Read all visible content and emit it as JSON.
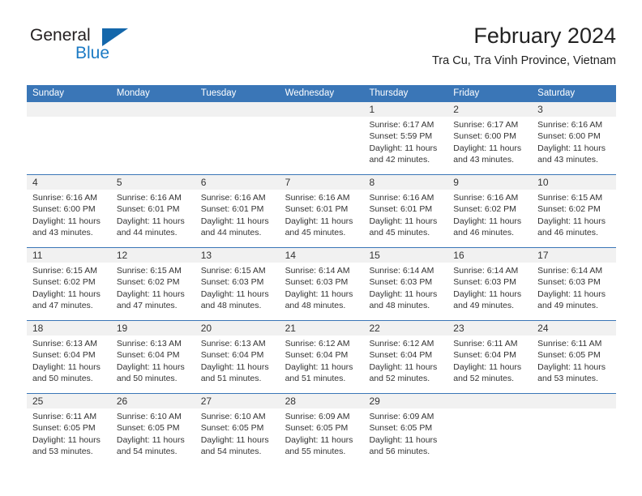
{
  "brand": {
    "name_part1": "General",
    "name_part2": "Blue",
    "triangle_icon": "blue-triangle-icon",
    "accent_color": "#1b7ac4"
  },
  "header": {
    "title": "February 2024",
    "subtitle": "Tra Cu, Tra Vinh Province, Vietnam"
  },
  "theme": {
    "header_bar_color": "#3a76b7",
    "daynum_band_color": "#f1f1f1",
    "text_color": "#333333"
  },
  "weekdays": [
    "Sunday",
    "Monday",
    "Tuesday",
    "Wednesday",
    "Thursday",
    "Friday",
    "Saturday"
  ],
  "labels": {
    "sunrise_prefix": "Sunrise:",
    "sunset_prefix": "Sunset:",
    "daylight_prefix": "Daylight:"
  },
  "weeks": [
    [
      {
        "day": "",
        "sunrise": "",
        "sunset": "",
        "daylight": ""
      },
      {
        "day": "",
        "sunrise": "",
        "sunset": "",
        "daylight": ""
      },
      {
        "day": "",
        "sunrise": "",
        "sunset": "",
        "daylight": ""
      },
      {
        "day": "",
        "sunrise": "",
        "sunset": "",
        "daylight": ""
      },
      {
        "day": "1",
        "sunrise": "Sunrise: 6:17 AM",
        "sunset": "Sunset: 5:59 PM",
        "daylight": "Daylight: 11 hours and 42 minutes."
      },
      {
        "day": "2",
        "sunrise": "Sunrise: 6:17 AM",
        "sunset": "Sunset: 6:00 PM",
        "daylight": "Daylight: 11 hours and 43 minutes."
      },
      {
        "day": "3",
        "sunrise": "Sunrise: 6:16 AM",
        "sunset": "Sunset: 6:00 PM",
        "daylight": "Daylight: 11 hours and 43 minutes."
      }
    ],
    [
      {
        "day": "4",
        "sunrise": "Sunrise: 6:16 AM",
        "sunset": "Sunset: 6:00 PM",
        "daylight": "Daylight: 11 hours and 43 minutes."
      },
      {
        "day": "5",
        "sunrise": "Sunrise: 6:16 AM",
        "sunset": "Sunset: 6:01 PM",
        "daylight": "Daylight: 11 hours and 44 minutes."
      },
      {
        "day": "6",
        "sunrise": "Sunrise: 6:16 AM",
        "sunset": "Sunset: 6:01 PM",
        "daylight": "Daylight: 11 hours and 44 minutes."
      },
      {
        "day": "7",
        "sunrise": "Sunrise: 6:16 AM",
        "sunset": "Sunset: 6:01 PM",
        "daylight": "Daylight: 11 hours and 45 minutes."
      },
      {
        "day": "8",
        "sunrise": "Sunrise: 6:16 AM",
        "sunset": "Sunset: 6:01 PM",
        "daylight": "Daylight: 11 hours and 45 minutes."
      },
      {
        "day": "9",
        "sunrise": "Sunrise: 6:16 AM",
        "sunset": "Sunset: 6:02 PM",
        "daylight": "Daylight: 11 hours and 46 minutes."
      },
      {
        "day": "10",
        "sunrise": "Sunrise: 6:15 AM",
        "sunset": "Sunset: 6:02 PM",
        "daylight": "Daylight: 11 hours and 46 minutes."
      }
    ],
    [
      {
        "day": "11",
        "sunrise": "Sunrise: 6:15 AM",
        "sunset": "Sunset: 6:02 PM",
        "daylight": "Daylight: 11 hours and 47 minutes."
      },
      {
        "day": "12",
        "sunrise": "Sunrise: 6:15 AM",
        "sunset": "Sunset: 6:02 PM",
        "daylight": "Daylight: 11 hours and 47 minutes."
      },
      {
        "day": "13",
        "sunrise": "Sunrise: 6:15 AM",
        "sunset": "Sunset: 6:03 PM",
        "daylight": "Daylight: 11 hours and 48 minutes."
      },
      {
        "day": "14",
        "sunrise": "Sunrise: 6:14 AM",
        "sunset": "Sunset: 6:03 PM",
        "daylight": "Daylight: 11 hours and 48 minutes."
      },
      {
        "day": "15",
        "sunrise": "Sunrise: 6:14 AM",
        "sunset": "Sunset: 6:03 PM",
        "daylight": "Daylight: 11 hours and 48 minutes."
      },
      {
        "day": "16",
        "sunrise": "Sunrise: 6:14 AM",
        "sunset": "Sunset: 6:03 PM",
        "daylight": "Daylight: 11 hours and 49 minutes."
      },
      {
        "day": "17",
        "sunrise": "Sunrise: 6:14 AM",
        "sunset": "Sunset: 6:03 PM",
        "daylight": "Daylight: 11 hours and 49 minutes."
      }
    ],
    [
      {
        "day": "18",
        "sunrise": "Sunrise: 6:13 AM",
        "sunset": "Sunset: 6:04 PM",
        "daylight": "Daylight: 11 hours and 50 minutes."
      },
      {
        "day": "19",
        "sunrise": "Sunrise: 6:13 AM",
        "sunset": "Sunset: 6:04 PM",
        "daylight": "Daylight: 11 hours and 50 minutes."
      },
      {
        "day": "20",
        "sunrise": "Sunrise: 6:13 AM",
        "sunset": "Sunset: 6:04 PM",
        "daylight": "Daylight: 11 hours and 51 minutes."
      },
      {
        "day": "21",
        "sunrise": "Sunrise: 6:12 AM",
        "sunset": "Sunset: 6:04 PM",
        "daylight": "Daylight: 11 hours and 51 minutes."
      },
      {
        "day": "22",
        "sunrise": "Sunrise: 6:12 AM",
        "sunset": "Sunset: 6:04 PM",
        "daylight": "Daylight: 11 hours and 52 minutes."
      },
      {
        "day": "23",
        "sunrise": "Sunrise: 6:11 AM",
        "sunset": "Sunset: 6:04 PM",
        "daylight": "Daylight: 11 hours and 52 minutes."
      },
      {
        "day": "24",
        "sunrise": "Sunrise: 6:11 AM",
        "sunset": "Sunset: 6:05 PM",
        "daylight": "Daylight: 11 hours and 53 minutes."
      }
    ],
    [
      {
        "day": "25",
        "sunrise": "Sunrise: 6:11 AM",
        "sunset": "Sunset: 6:05 PM",
        "daylight": "Daylight: 11 hours and 53 minutes."
      },
      {
        "day": "26",
        "sunrise": "Sunrise: 6:10 AM",
        "sunset": "Sunset: 6:05 PM",
        "daylight": "Daylight: 11 hours and 54 minutes."
      },
      {
        "day": "27",
        "sunrise": "Sunrise: 6:10 AM",
        "sunset": "Sunset: 6:05 PM",
        "daylight": "Daylight: 11 hours and 54 minutes."
      },
      {
        "day": "28",
        "sunrise": "Sunrise: 6:09 AM",
        "sunset": "Sunset: 6:05 PM",
        "daylight": "Daylight: 11 hours and 55 minutes."
      },
      {
        "day": "29",
        "sunrise": "Sunrise: 6:09 AM",
        "sunset": "Sunset: 6:05 PM",
        "daylight": "Daylight: 11 hours and 56 minutes."
      },
      {
        "day": "",
        "sunrise": "",
        "sunset": "",
        "daylight": ""
      },
      {
        "day": "",
        "sunrise": "",
        "sunset": "",
        "daylight": ""
      }
    ]
  ]
}
